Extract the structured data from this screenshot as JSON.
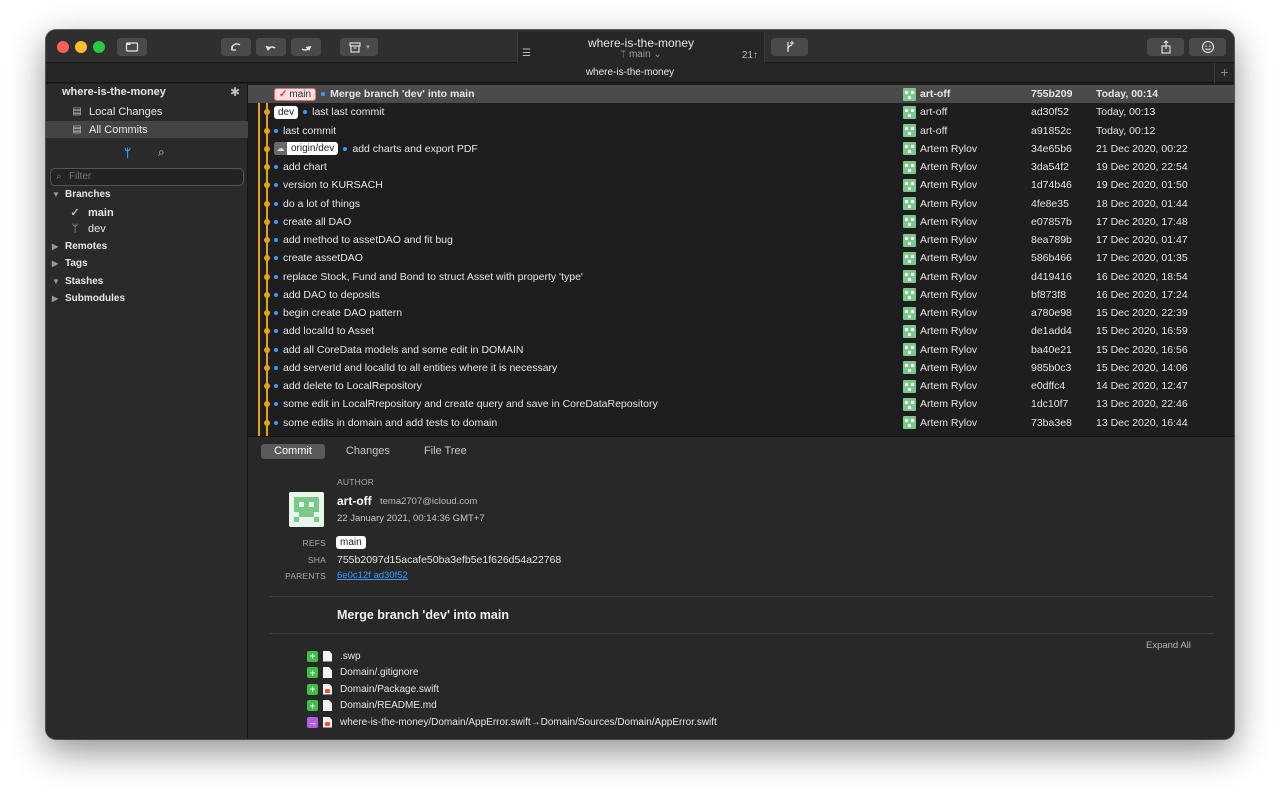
{
  "toolbar": {
    "repo_title": "where-is-the-money",
    "branch": "main",
    "ahead_count": "21↑"
  },
  "tabbar": {
    "title": "where-is-the-money"
  },
  "sidebar": {
    "repo_name": "where-is-the-money",
    "items": [
      {
        "label": "Local Changes",
        "icon": "document-icon"
      },
      {
        "label": "All Commits",
        "icon": "commits-icon"
      }
    ],
    "filter_placeholder": "Filter",
    "branches_label": "Branches",
    "branches": [
      {
        "label": "main",
        "current": true
      },
      {
        "label": "dev",
        "current": false
      }
    ],
    "remotes_label": "Remotes",
    "tags_label": "Tags",
    "stashes_label": "Stashes",
    "submodules_label": "Submodules"
  },
  "commits": [
    {
      "refs": [
        "main"
      ],
      "message": "Merge branch 'dev' into main",
      "author": "art-off",
      "sha": "755b209",
      "date": "Today, 00:14"
    },
    {
      "refs": [
        "dev"
      ],
      "message": "last last commit",
      "author": "art-off",
      "sha": "ad30f52",
      "date": "Today, 00:13"
    },
    {
      "refs": [],
      "message": "last commit",
      "author": "art-off",
      "sha": "a91852c",
      "date": "Today, 00:12"
    },
    {
      "refs": [
        "origin/dev"
      ],
      "message": "add charts and export PDF",
      "author": "Artem Rylov",
      "sha": "34e65b6",
      "date": "21 Dec 2020, 00:22"
    },
    {
      "refs": [],
      "message": "add chart",
      "author": "Artem Rylov",
      "sha": "3da54f2",
      "date": "19 Dec 2020, 22:54"
    },
    {
      "refs": [],
      "message": "version to KURSACH",
      "author": "Artem Rylov",
      "sha": "1d74b46",
      "date": "19 Dec 2020, 01:50"
    },
    {
      "refs": [],
      "message": "do a lot of things",
      "author": "Artem Rylov",
      "sha": "4fe8e35",
      "date": "18 Dec 2020, 01:44"
    },
    {
      "refs": [],
      "message": "create all DAO",
      "author": "Artem Rylov",
      "sha": "e07857b",
      "date": "17 Dec 2020, 17:48"
    },
    {
      "refs": [],
      "message": "add method to assetDAO and fit bug",
      "author": "Artem Rylov",
      "sha": "8ea789b",
      "date": "17 Dec 2020, 01:47"
    },
    {
      "refs": [],
      "message": "create assetDAO",
      "author": "Artem Rylov",
      "sha": "586b466",
      "date": "17 Dec 2020, 01:35"
    },
    {
      "refs": [],
      "message": "replace Stock, Fund and Bond to struct Asset with property 'type'",
      "author": "Artem Rylov",
      "sha": "d419416",
      "date": "16 Dec 2020, 18:54"
    },
    {
      "refs": [],
      "message": "add DAO to deposits",
      "author": "Artem Rylov",
      "sha": "bf873f8",
      "date": "16 Dec 2020, 17:24"
    },
    {
      "refs": [],
      "message": "begin create DAO pattern",
      "author": "Artem Rylov",
      "sha": "a780e98",
      "date": "15 Dec 2020, 22:39"
    },
    {
      "refs": [],
      "message": "add localId to Asset",
      "author": "Artem Rylov",
      "sha": "de1add4",
      "date": "15 Dec 2020, 16:59"
    },
    {
      "refs": [],
      "message": "add all CoreData models and some edit in DOMAIN",
      "author": "Artem Rylov",
      "sha": "ba40e21",
      "date": "15 Dec 2020, 16:56"
    },
    {
      "refs": [],
      "message": "add serverId and localId to all entities where it is necessary",
      "author": "Artem Rylov",
      "sha": "985b0c3",
      "date": "15 Dec 2020, 14:06"
    },
    {
      "refs": [],
      "message": "add delete to LocalRepository",
      "author": "Artem Rylov",
      "sha": "e0dffc4",
      "date": "14 Dec 2020, 12:47"
    },
    {
      "refs": [],
      "message": "some edit in LocalRrepository and create query and save in CoreDataRepository",
      "author": "Artem Rylov",
      "sha": "1dc10f7",
      "date": "13 Dec 2020, 22:46"
    },
    {
      "refs": [],
      "message": "some edits in domain and add tests to domain",
      "author": "Artem Rylov",
      "sha": "73ba3e8",
      "date": "13 Dec 2020, 16:44"
    }
  ],
  "detail": {
    "tabs": [
      "Commit",
      "Changes",
      "File Tree"
    ],
    "author_heading": "AUTHOR",
    "author_name": "art-off",
    "author_email": "tema2707@icloud.com",
    "author_date": "22 January 2021, 00:14:36 GMT+7",
    "refs_label": "REFS",
    "ref": "main",
    "sha_label": "SHA",
    "sha": "755b2097d15acafe50ba3efb5e1f626d54a22768",
    "parents_label": "PARENTS",
    "parent1": "6e0c12f",
    "parent2": "ad30f52",
    "message": "Merge branch 'dev' into main",
    "expand_all": "Expand All",
    "files": [
      {
        "status": "+",
        "type": "added",
        "name": ".swp",
        "icon": "file-icon"
      },
      {
        "status": "+",
        "type": "added",
        "name": "Domain/.gitignore",
        "icon": "file-icon"
      },
      {
        "status": "+",
        "type": "added",
        "name": "Domain/Package.swift",
        "icon": "swift-file-icon"
      },
      {
        "status": "+",
        "type": "added",
        "name": "Domain/README.md",
        "icon": "file-icon"
      },
      {
        "status": "→",
        "type": "renamed",
        "name": "where-is-the-money/Domain/AppError.swift→Domain/Sources/Domain/AppError.swift",
        "icon": "swift-file-icon"
      }
    ]
  }
}
